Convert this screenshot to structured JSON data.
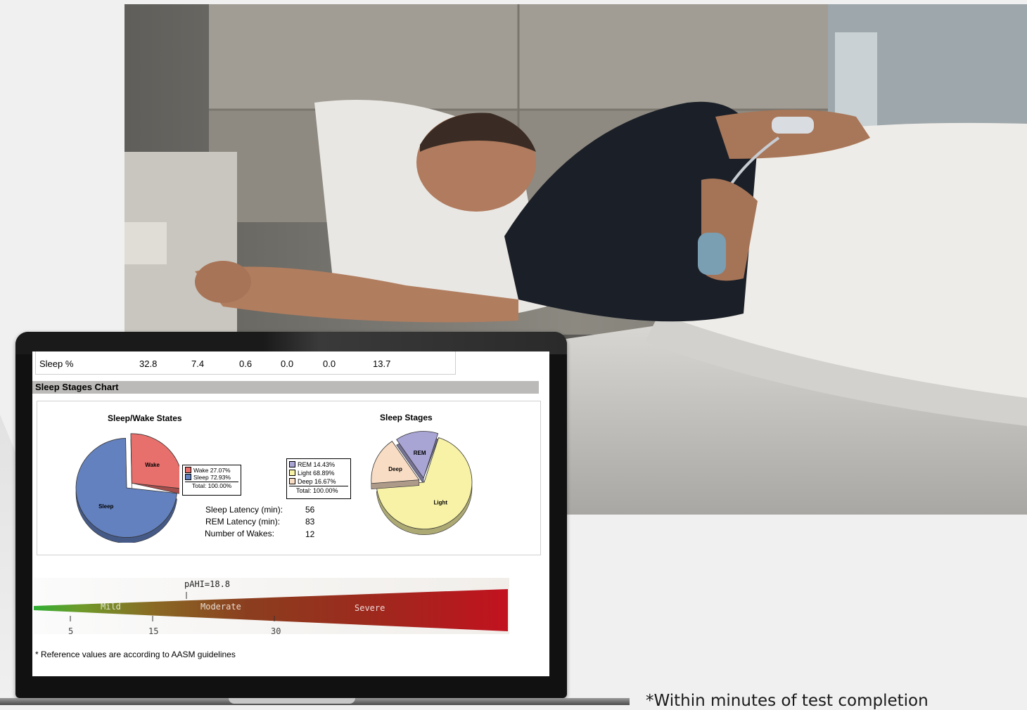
{
  "table": {
    "row_label": "Sleep %",
    "values": [
      "32.8",
      "7.4",
      "0.6",
      "0.0",
      "0.0",
      "13.7"
    ]
  },
  "section_title": "Sleep Stages Chart",
  "charts": {
    "sleep_wake_title": "Sleep/Wake States",
    "sleep_stages_title": "Sleep Stages"
  },
  "chart_data": [
    {
      "type": "pie",
      "title": "Sleep/Wake States",
      "categories": [
        "Wake",
        "Sleep"
      ],
      "values": [
        27.07,
        72.93
      ],
      "colors": [
        "#e8706c",
        "#6381bf"
      ],
      "legend_total": "Total: 100.00%",
      "legend_labels": [
        "Wake  27.07%",
        "Sleep  72.93%"
      ]
    },
    {
      "type": "pie",
      "title": "Sleep Stages",
      "categories": [
        "REM",
        "Light",
        "Deep"
      ],
      "values": [
        14.43,
        68.89,
        16.67
      ],
      "colors": [
        "#a8a4d4",
        "#f7f2a6",
        "#f8dcc4"
      ],
      "legend_total": "Total: 100.00%",
      "legend_labels": [
        "REM  14.43%",
        "Light  68.89%",
        "Deep  16.67%"
      ]
    }
  ],
  "stats": {
    "sleep_latency_label": "Sleep Latency (min):",
    "sleep_latency_value": "56",
    "rem_latency_label": "REM Latency (min):",
    "rem_latency_value": "83",
    "wakes_label": "Number of Wakes:",
    "wakes_value": "12"
  },
  "severity": {
    "pahi_label": "pAHI=18.8",
    "pahi_value": 18.8,
    "zones": [
      "Mild",
      "Moderate",
      "Severe"
    ],
    "ticks": [
      "5",
      "15",
      "30"
    ]
  },
  "reference_note": "* Reference values are according to AASM guidelines",
  "footnote": "*Within minutes of test completion",
  "colors": {
    "mild": "#3aa537",
    "moderate": "#8a4a1e",
    "severe": "#b5121b"
  }
}
